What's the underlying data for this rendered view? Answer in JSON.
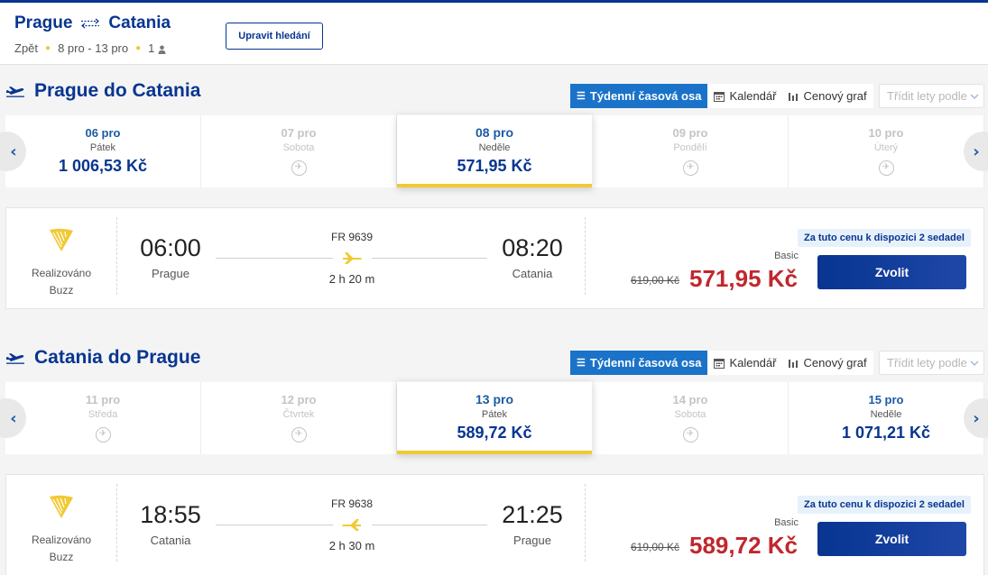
{
  "header": {
    "origin": "Prague",
    "destination": "Catania",
    "back_label": "Zpět",
    "dates": "8 pro - 13 pro",
    "passengers": "1",
    "edit_button": "Upravit hledání"
  },
  "colors": {
    "brand": "#073590",
    "accent": "#f1c933",
    "price": "#c1272d",
    "tab_active": "#1a73c8"
  },
  "view_tabs": {
    "weekly": "Týdenní časová osa",
    "calendar": "Kalendář",
    "price_chart": "Cenový graf",
    "sort_placeholder": "Třídit lety podle"
  },
  "outbound": {
    "title": "Prague do Catania",
    "dates": [
      {
        "date": "06 pro",
        "day": "Pátek",
        "price": "1 006,53 Kč",
        "state": "available"
      },
      {
        "date": "07 pro",
        "day": "Sobota",
        "price": "",
        "state": "disabled"
      },
      {
        "date": "08 pro",
        "day": "Neděle",
        "price": "571,95 Kč",
        "state": "selected"
      },
      {
        "date": "09 pro",
        "day": "Pondělí",
        "price": "",
        "state": "disabled"
      },
      {
        "date": "10 pro",
        "day": "Úterý",
        "price": "",
        "state": "disabled"
      }
    ],
    "flight": {
      "operated_by_line1": "Realizováno",
      "operated_by_line2": "Buzz",
      "dep_time": "06:00",
      "dep_city": "Prague",
      "flight_no": "FR 9639",
      "duration": "2 h 20 m",
      "arr_time": "08:20",
      "arr_city": "Catania",
      "availability": "Za tuto cenu k dispozici 2 sedadel",
      "fare": "Basic",
      "old_price": "619,00 Kč",
      "price": "571,95 Kč",
      "select": "Zvolit"
    }
  },
  "inbound": {
    "title": "Catania do Prague",
    "dates": [
      {
        "date": "11 pro",
        "day": "Středa",
        "price": "",
        "state": "disabled"
      },
      {
        "date": "12 pro",
        "day": "Čtvrtek",
        "price": "",
        "state": "disabled"
      },
      {
        "date": "13 pro",
        "day": "Pátek",
        "price": "589,72 Kč",
        "state": "selected"
      },
      {
        "date": "14 pro",
        "day": "Sobota",
        "price": "",
        "state": "disabled"
      },
      {
        "date": "15 pro",
        "day": "Neděle",
        "price": "1 071,21 Kč",
        "state": "available"
      }
    ],
    "flight": {
      "operated_by_line1": "Realizováno",
      "operated_by_line2": "Buzz",
      "dep_time": "18:55",
      "dep_city": "Catania",
      "flight_no": "FR 9638",
      "duration": "2 h 30 m",
      "arr_time": "21:25",
      "arr_city": "Prague",
      "availability": "Za tuto cenu k dispozici 2 sedadel",
      "fare": "Basic",
      "old_price": "619,00 Kč",
      "price": "589,72 Kč",
      "select": "Zvolit"
    }
  }
}
